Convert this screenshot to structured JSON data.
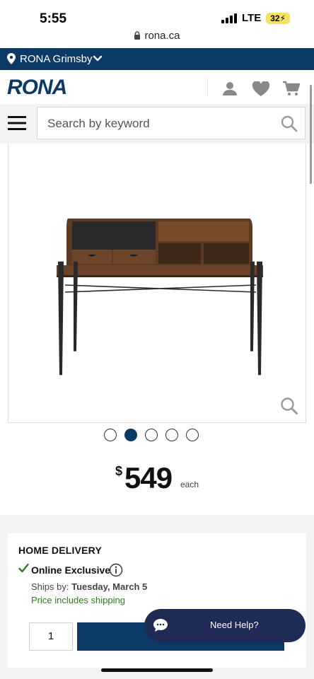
{
  "status_bar": {
    "time": "5:55",
    "network": "LTE",
    "battery": "32"
  },
  "browser": {
    "url": "rona.ca"
  },
  "store_bar": {
    "store": "RONA Grimsby"
  },
  "header": {
    "logo": "RONA"
  },
  "search": {
    "placeholder": "Search by keyword"
  },
  "carousel": {
    "count": 5,
    "active_index": 1
  },
  "price": {
    "currency": "$",
    "amount": "549",
    "unit": "each"
  },
  "delivery": {
    "title": "HOME DELIVERY",
    "badge": "Online Exclusive",
    "ships_label": "Ships by:",
    "ships_date": "Tuesday, March 5",
    "shipping_note": "Price includes shipping",
    "quantity": "1"
  },
  "help": {
    "label": "Need Help?"
  },
  "colors": {
    "brand": "#0b3a67",
    "success": "#2e7d20",
    "help_bg": "#1f2a55"
  }
}
